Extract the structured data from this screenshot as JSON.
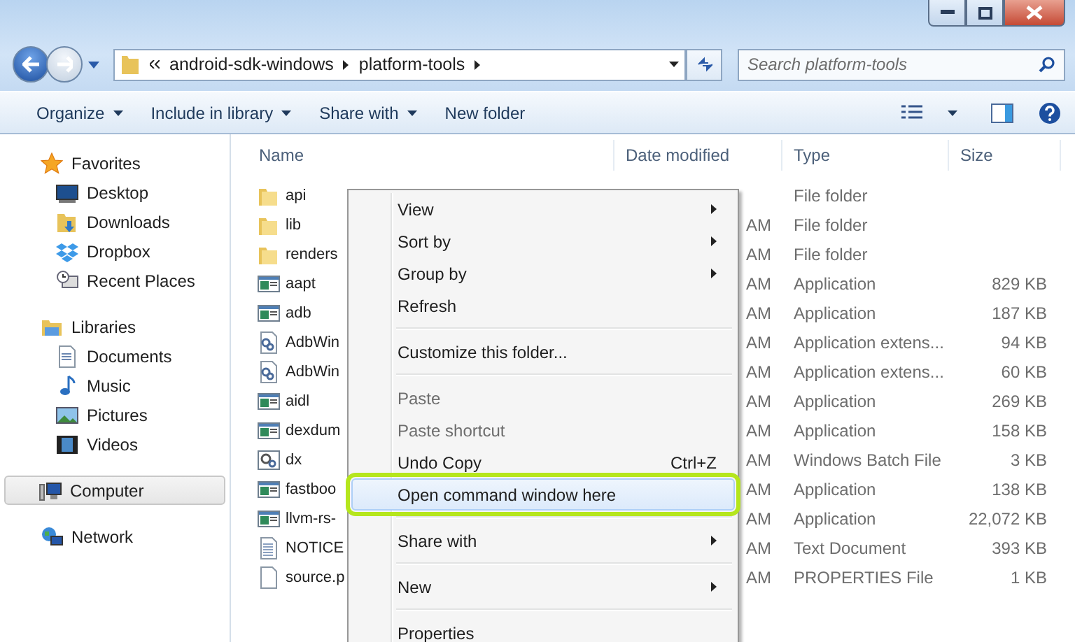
{
  "address": {
    "path": [
      "android-sdk-windows",
      "platform-tools"
    ]
  },
  "search": {
    "placeholder": "Search platform-tools"
  },
  "toolbar": [
    "Organize",
    "Include in library",
    "Share with"
  ],
  "toolbar_plain": "New folder",
  "sidebar": [
    {
      "label": "Favorites",
      "selected": false,
      "children": [
        {
          "label": "Desktop"
        },
        {
          "label": "Downloads"
        },
        {
          "label": "Dropbox"
        },
        {
          "label": "Recent Places"
        }
      ]
    },
    {
      "label": "Libraries",
      "selected": false,
      "children": [
        {
          "label": "Documents"
        },
        {
          "label": "Music"
        },
        {
          "label": "Pictures"
        },
        {
          "label": "Videos"
        }
      ]
    },
    {
      "label": "Computer",
      "selected": true
    },
    {
      "label": "Network",
      "selected": false
    }
  ],
  "table": {
    "columns": [
      "Name",
      "Date modified",
      "Type",
      "Size"
    ],
    "rows": [
      {
        "kind": "folder",
        "name": "api",
        "date": "",
        "type": "File folder",
        "size": ""
      },
      {
        "kind": "folder",
        "name": "lib",
        "date": "AM",
        "type": "File folder",
        "size": ""
      },
      {
        "kind": "folder",
        "name": "renders",
        "date": "AM",
        "type": "File folder",
        "size": ""
      },
      {
        "kind": "app",
        "name": "aapt",
        "date": "AM",
        "type": "Application",
        "size": "829 KB"
      },
      {
        "kind": "app",
        "name": "adb",
        "date": "AM",
        "type": "Application",
        "size": "187 KB"
      },
      {
        "kind": "dll",
        "name": "AdbWin",
        "date": "AM",
        "type": "Application extens...",
        "size": "94 KB"
      },
      {
        "kind": "dll",
        "name": "AdbWin",
        "date": "AM",
        "type": "Application extens...",
        "size": "60 KB"
      },
      {
        "kind": "app",
        "name": "aidl",
        "date": "AM",
        "type": "Application",
        "size": "269 KB"
      },
      {
        "kind": "app",
        "name": "dexdum",
        "date": "AM",
        "type": "Application",
        "size": "158 KB"
      },
      {
        "kind": "bat",
        "name": "dx",
        "date": "AM",
        "type": "Windows Batch File",
        "size": "3 KB"
      },
      {
        "kind": "app",
        "name": "fastboo",
        "date": "AM",
        "type": "Application",
        "size": "138 KB"
      },
      {
        "kind": "app",
        "name": "llvm-rs-",
        "date": "AM",
        "type": "Application",
        "size": "22,072 KB"
      },
      {
        "kind": "text",
        "name": "NOTICE",
        "date": "AM",
        "type": "Text Document",
        "size": "393 KB"
      },
      {
        "kind": "file",
        "name": "source.p",
        "date": "AM",
        "type": "PROPERTIES File",
        "size": "1 KB"
      }
    ]
  },
  "context_menu": [
    {
      "kind": "item",
      "label": "View",
      "submenu": true,
      "disabled": false,
      "highlighted": false
    },
    {
      "kind": "item",
      "label": "Sort by",
      "submenu": true,
      "disabled": false,
      "highlighted": false
    },
    {
      "kind": "item",
      "label": "Group by",
      "submenu": true,
      "disabled": false,
      "highlighted": false
    },
    {
      "kind": "item",
      "label": "Refresh",
      "submenu": false,
      "disabled": false,
      "highlighted": false
    },
    {
      "kind": "separator"
    },
    {
      "kind": "item",
      "label": "Customize this folder...",
      "submenu": false,
      "disabled": false,
      "highlighted": false
    },
    {
      "kind": "separator"
    },
    {
      "kind": "item",
      "label": "Paste",
      "submenu": false,
      "disabled": true,
      "highlighted": false
    },
    {
      "kind": "item",
      "label": "Paste shortcut",
      "submenu": false,
      "disabled": true,
      "highlighted": false
    },
    {
      "kind": "item",
      "label": "Undo Copy",
      "shortcut": "Ctrl+Z",
      "submenu": false,
      "disabled": false,
      "highlighted": false
    },
    {
      "kind": "item",
      "label": "Open command window here",
      "submenu": false,
      "disabled": false,
      "highlighted": true
    },
    {
      "kind": "separator"
    },
    {
      "kind": "item",
      "label": "Share with",
      "submenu": true,
      "disabled": false,
      "highlighted": false
    },
    {
      "kind": "separator"
    },
    {
      "kind": "item",
      "label": "New",
      "submenu": true,
      "disabled": false,
      "highlighted": false
    },
    {
      "kind": "separator"
    },
    {
      "kind": "item",
      "label": "Properties",
      "submenu": false,
      "disabled": false,
      "highlighted": false
    }
  ]
}
